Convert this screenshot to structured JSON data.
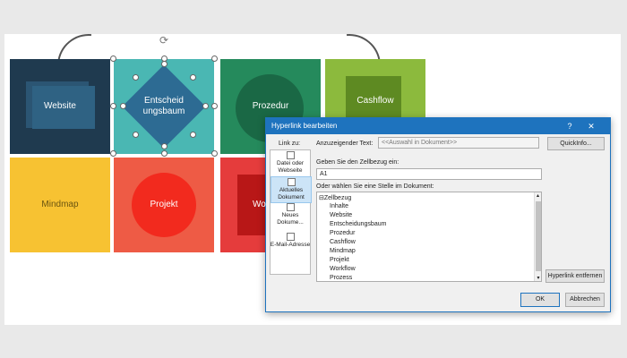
{
  "tiles": [
    {
      "label": "Website"
    },
    {
      "label": "Entscheid\nungsbaum"
    },
    {
      "label": "Prozedur"
    },
    {
      "label": "Cashflow"
    },
    {
      "label": "Mindmap"
    },
    {
      "label": "Projekt"
    },
    {
      "label": "Wo"
    }
  ],
  "dialog": {
    "title": "Hyperlink bearbeiten",
    "help": "?",
    "close": "✕",
    "link_to_label": "Link zu:",
    "display_text_label": "Anzuzeigender Text:",
    "display_text_value": "<<Auswahl in Dokument>>",
    "quickinfo_button": "QuickInfo...",
    "cell_ref_label": "Geben Sie den Zellbezug ein:",
    "cell_ref_value": "A1",
    "place_label": "Oder wählen Sie eine Stelle im Dokument:",
    "tree_root": "Zellbezug",
    "tree_items": [
      "Inhalte",
      "Website",
      "Entscheidungsbaum",
      "Prozedur",
      "Cashflow",
      "Mindmap",
      "Projekt",
      "Workflow",
      "Prozess"
    ],
    "nav": [
      {
        "label": "Datei oder Webseite"
      },
      {
        "label": "Aktuelles Dokument"
      },
      {
        "label": "Neues Dokume..."
      },
      {
        "label": "E-Mail-Adresse"
      }
    ],
    "remove_link_button": "Hyperlink entfernen",
    "ok_button": "OK",
    "cancel_button": "Abbrechen"
  },
  "colors": {
    "website": "#1f3a4f",
    "entscheidung": "#4ab7b3",
    "prozedur": "#258a5c",
    "cashflow": "#8cba3d",
    "mindmap": "#f7c232",
    "projekt": "#ee5b45",
    "workflow": "#e53c3c",
    "accent": "#1e73be"
  }
}
